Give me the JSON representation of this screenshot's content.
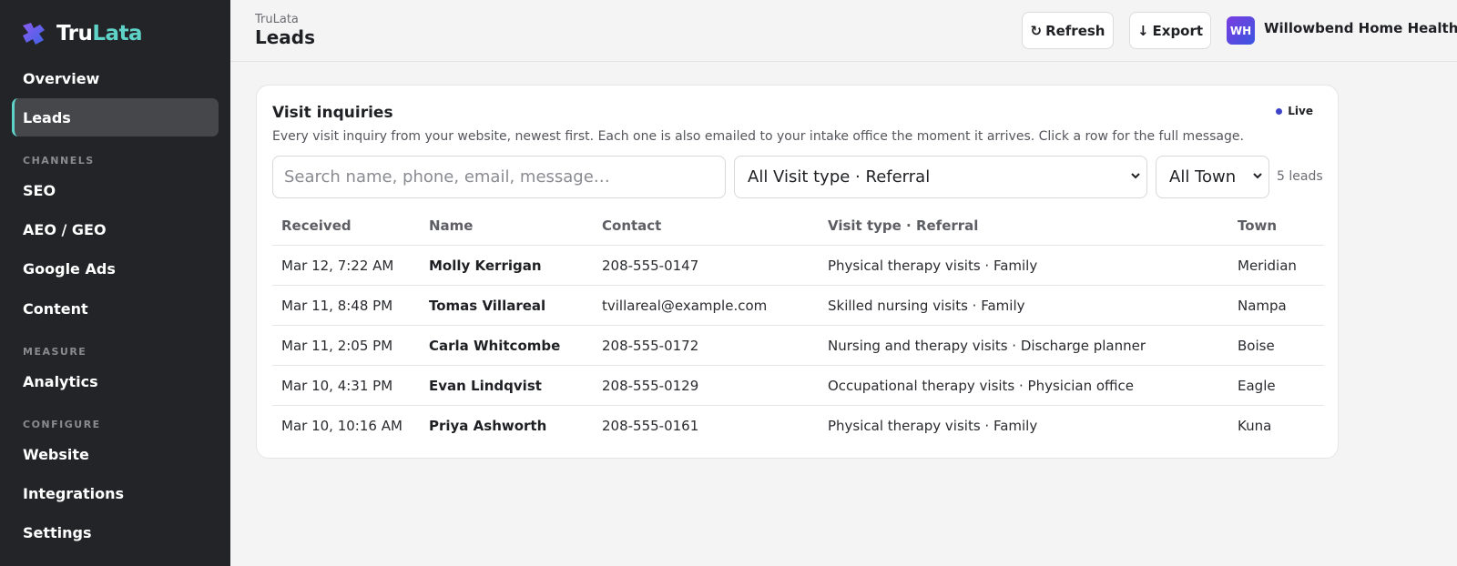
{
  "app": {
    "name_part1": "Tru",
    "name_part2": "Lata",
    "colors": {
      "accent": "#5fd3c8",
      "sidebar_bg": "#232427",
      "live_dot": "#3d44c8"
    }
  },
  "sidebar": {
    "items_top": [
      {
        "label": "Overview",
        "active": false
      },
      {
        "label": "Leads",
        "active": true
      }
    ],
    "section_channels": "CHANNELS",
    "channels": [
      {
        "label": "SEO"
      },
      {
        "label": "AEO / GEO"
      },
      {
        "label": "Google Ads"
      },
      {
        "label": "Content"
      }
    ],
    "section_measure": "MEASURE",
    "measure": [
      {
        "label": "Analytics"
      }
    ],
    "section_configure": "CONFIGURE",
    "configure": [
      {
        "label": "Website"
      },
      {
        "label": "Integrations"
      },
      {
        "label": "Settings"
      }
    ]
  },
  "header": {
    "breadcrumb": "TruLata",
    "title": "Leads",
    "refresh_label": "Refresh",
    "refresh_icon": "refresh-icon",
    "export_label": "Export",
    "export_icon": "arrow-down-icon",
    "org_initials": "WH",
    "org_name": "Willowbend Home Health"
  },
  "card": {
    "title": "Visit inquiries",
    "description": "Every visit inquiry from your website, newest first. Each one is also emailed to your intake office the moment it arrives. Click a row for the full message.",
    "live_label": "Live",
    "search_placeholder": "Search name, phone, email, message…",
    "visit_filter": "All Visit type · Referral",
    "town_filter": "All Town",
    "lead_count": "5 leads"
  },
  "table": {
    "headers": {
      "received": "Received",
      "name": "Name",
      "contact": "Contact",
      "visit": "Visit type · Referral",
      "town": "Town"
    },
    "rows": [
      {
        "received": "Mar 12, 7:22 AM",
        "name": "Molly Kerrigan",
        "contact": "208-555-0147",
        "visit": "Physical therapy visits · Family",
        "town": "Meridian"
      },
      {
        "received": "Mar 11, 8:48 PM",
        "name": "Tomas Villareal",
        "contact": "tvillareal@example.com",
        "visit": "Skilled nursing visits · Family",
        "town": "Nampa"
      },
      {
        "received": "Mar 11, 2:05 PM",
        "name": "Carla Whitcombe",
        "contact": "208-555-0172",
        "visit": "Nursing and therapy visits · Discharge planner",
        "town": "Boise"
      },
      {
        "received": "Mar 10, 4:31 PM",
        "name": "Evan Lindqvist",
        "contact": "208-555-0129",
        "visit": "Occupational therapy visits · Physician office",
        "town": "Eagle"
      },
      {
        "received": "Mar 10, 10:16 AM",
        "name": "Priya Ashworth",
        "contact": "208-555-0161",
        "visit": "Physical therapy visits · Family",
        "town": "Kuna"
      }
    ]
  }
}
